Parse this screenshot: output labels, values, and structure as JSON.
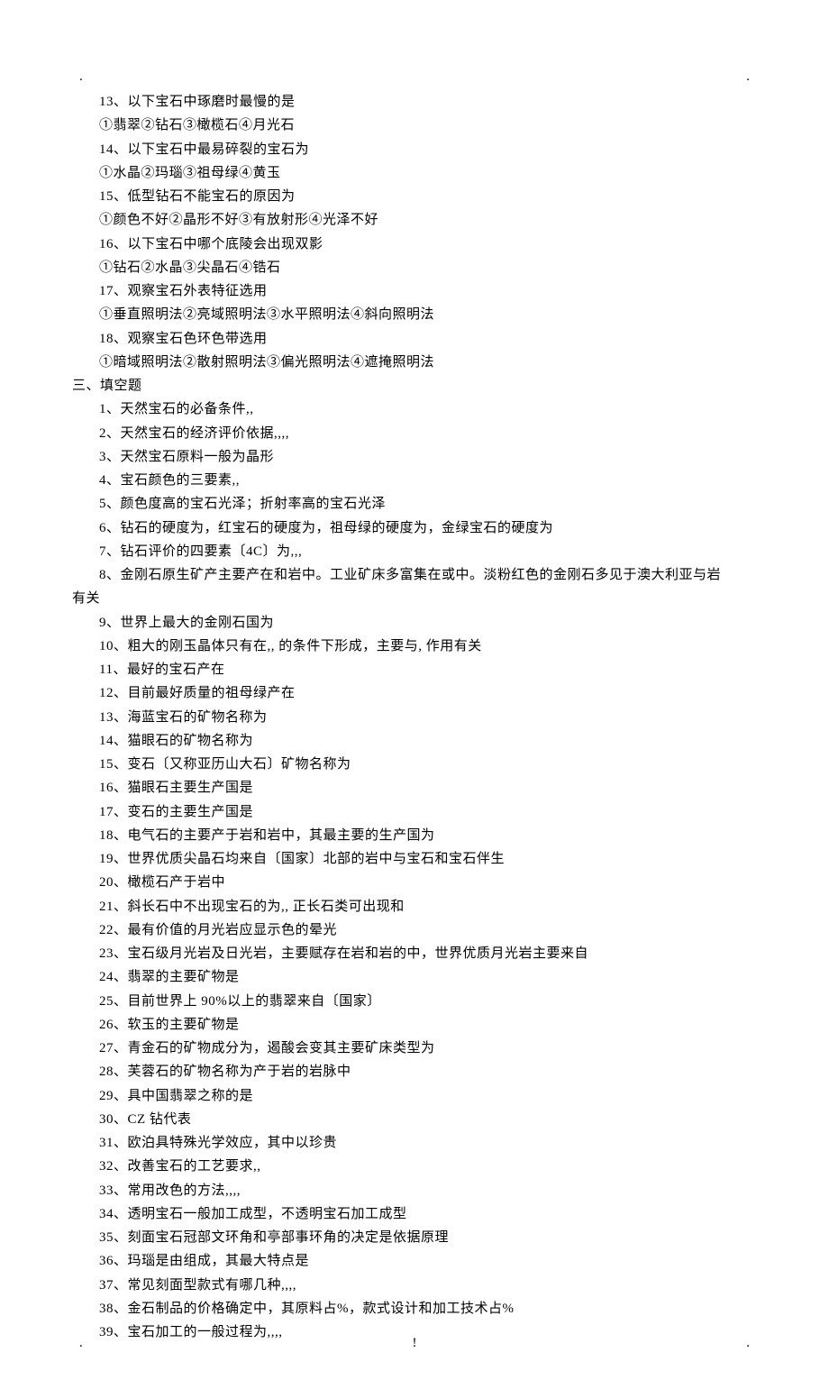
{
  "corners": {
    "mark": "."
  },
  "pageNumber": "!",
  "mcq": [
    {
      "n": "13",
      "q": "以下宝石中琢磨时最慢的是",
      "opts": "①翡翠②钻石③橄榄石④月光石"
    },
    {
      "n": "14",
      "q": "以下宝石中最易碎裂的宝石为",
      "opts": "①水晶②玛瑙③祖母绿④黄玉"
    },
    {
      "n": "15",
      "q": "低型钻石不能宝石的原因为",
      "opts": "①颜色不好②晶形不好③有放射形④光泽不好"
    },
    {
      "n": "16",
      "q": "以下宝石中哪个底陵会出现双影",
      "opts": "①钻石②水晶③尖晶石④锆石"
    },
    {
      "n": "17",
      "q": "观察宝石外表特征选用",
      "opts": "①垂直照明法②亮域照明法③水平照明法④斜向照明法"
    },
    {
      "n": "18",
      "q": "观察宝石色环色带选用",
      "opts": "①暗域照明法②散射照明法③偏光照明法④遮掩照明法"
    }
  ],
  "section3": "三、填空题",
  "fill": [
    "1、天然宝石的必备条件,,",
    "2、天然宝石的经济评价依据,,,,",
    "3、天然宝石原料一般为晶形",
    "4、宝石颜色的三要素,,",
    "5、颜色度高的宝石光泽；折射率高的宝石光泽",
    "6、钻石的硬度为，红宝石的硬度为，祖母绿的硬度为，金绿宝石的硬度为",
    "7、钻石评价的四要素〔4C〕为,,,"
  ],
  "fill8": "8、金刚石原生矿产主要产在和岩中。工业矿床多富集在或中。淡粉红色的金刚石多见于澳大利亚与岩",
  "fill8b": "有关",
  "fill_rest": [
    "9、世界上最大的金刚石国为",
    "10、粗大的刚玉晶体只有在,, 的条件下形成，主要与, 作用有关",
    "11、最好的宝石产在",
    "12、目前最好质量的祖母绿产在",
    "13、海蓝宝石的矿物名称为",
    "14、猫眼石的矿物名称为",
    "15、变石〔又称亚历山大石〕矿物名称为",
    "16、猫眼石主要生产国是",
    "17、变石的主要生产国是",
    "18、电气石的主要产于岩和岩中，其最主要的生产国为",
    "19、世界优质尖晶石均来自〔国家〕北部的岩中与宝石和宝石伴生",
    "20、橄榄石产于岩中",
    "21、斜长石中不出现宝石的为,, 正长石类可出现和",
    "22、最有价值的月光岩应显示色的晕光",
    "23、宝石级月光岩及日光岩，主要赋存在岩和岩的中，世界优质月光岩主要来自",
    "24、翡翠的主要矿物是",
    "25、目前世界上 90%以上的翡翠来自〔国家〕",
    "26、软玉的主要矿物是",
    "27、青金石的矿物成分为，遏酸会变其主要矿床类型为",
    "28、芙蓉石的矿物名称为产于岩的岩脉中",
    "29、具中国翡翠之称的是",
    "30、CZ 钻代表",
    "31、欧泊具特殊光学效应，其中以珍贵",
    "32、改善宝石的工艺要求,,",
    "33、常用改色的方法,,,,",
    "34、透明宝石一般加工成型，不透明宝石加工成型",
    "35、刻面宝石冠部文环角和亭部事环角的决定是依据原理",
    "36、玛瑙是由组成，其最大特点是",
    "37、常见刻面型款式有哪几种,,,,",
    "38、金石制品的价格确定中，其原料占%，款式设计和加工技术占%",
    "39、宝石加工的一般过程为,,,,"
  ]
}
